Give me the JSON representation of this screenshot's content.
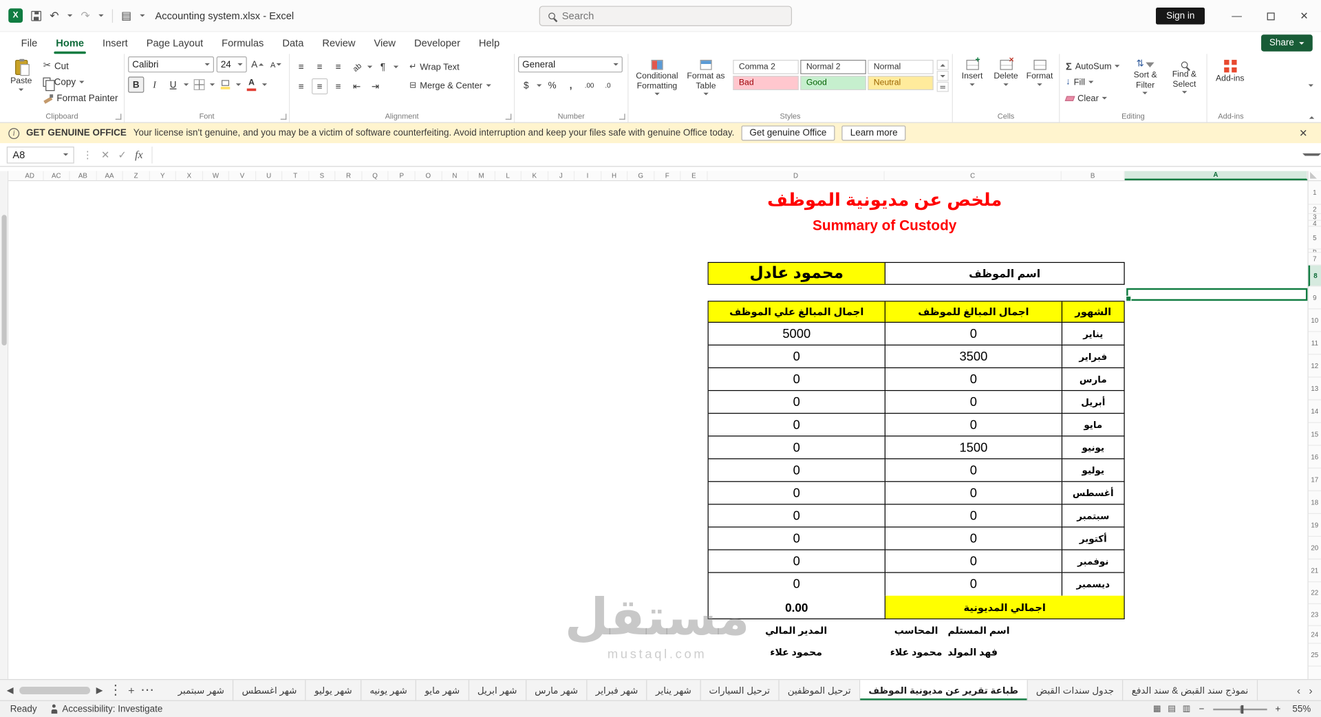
{
  "colors": {
    "excel_green": "#107C41",
    "share_button_green": "#185C37",
    "title_red": "#FF0000",
    "table_highlight_yellow": "#FFFF00",
    "license_bar_bg": "#FFF4CE",
    "style_bad_bg": "#FFC7CE",
    "style_bad_text": "#9C0006",
    "style_good_bg": "#C6EFCE",
    "style_good_text": "#006100",
    "style_neutral_bg": "#FFEB9C",
    "style_neutral_text": "#9C6500"
  },
  "icons": {
    "excel_logo": "X",
    "undo": "↶",
    "redo": "↷",
    "workbook": "▤",
    "minimize": "—",
    "close": "✕",
    "cancel": "✕",
    "confirm": "✓",
    "cut": "✂",
    "grow_font": "A",
    "shrink_font": "A",
    "orient": "ab",
    "paragraph": "¶",
    "align": "≡",
    "indent_out": "⇤",
    "indent_in": "⇥",
    "wrap": "↵",
    "merge": "⊟",
    "dollar": "$",
    "percent": "%",
    "comma": ",",
    "inc_decimal": ".00",
    "dec_decimal": ".0",
    "autosum": "Σ",
    "fill_down": "↓",
    "sort_arrows": "⇅",
    "dots_v": "⋮",
    "dots_h": "⋯",
    "plus": "+",
    "scroll_left": "◂",
    "scroll_right": "▸",
    "tab_prev": "‹",
    "tab_next": "›",
    "view_normal": "▦",
    "view_layout": "▤",
    "view_break": "▥",
    "zoom_out": "−",
    "zoom_in": "+",
    "info": "i"
  },
  "titlebar": {
    "document_title": "Accounting system.xlsx  -  Excel",
    "search_placeholder": "Search",
    "sign_in_label": "Sign in"
  },
  "menubar": {
    "tabs": [
      "File",
      "Home",
      "Insert",
      "Page Layout",
      "Formulas",
      "Data",
      "Review",
      "View",
      "Developer",
      "Help"
    ],
    "active_tab": "Home",
    "share_label": "Share"
  },
  "ribbon": {
    "clipboard": {
      "label": "Clipboard",
      "paste_label": "Paste",
      "cut_label": "Cut",
      "copy_label": "Copy",
      "format_painter_label": "Format Painter"
    },
    "font": {
      "label": "Font",
      "font_name": "Calibri",
      "font_size": "24",
      "bold_label": "B",
      "italic_label": "I",
      "underline_label": "U"
    },
    "alignment": {
      "label": "Alignment",
      "wrap_text_label": "Wrap Text",
      "merge_center_label": "Merge & Center"
    },
    "number": {
      "label": "Number",
      "format_value": "General"
    },
    "styles": {
      "label": "Styles",
      "conditional_formatting_label": "Conditional Formatting",
      "format_as_table_label": "Format as Table",
      "gallery": [
        "Comma 2",
        "Normal 2",
        "Normal",
        "Bad",
        "Good",
        "Neutral"
      ]
    },
    "cells": {
      "label": "Cells",
      "insert_label": "Insert",
      "delete_label": "Delete",
      "format_label": "Format"
    },
    "editing": {
      "label": "Editing",
      "autosum_label": "AutoSum",
      "fill_label": "Fill",
      "clear_label": "Clear",
      "sort_filter_label": "Sort & Filter",
      "find_select_label": "Find & Select"
    },
    "addins": {
      "label": "Add-ins",
      "addins_label": "Add-ins"
    }
  },
  "license_bar": {
    "badge": "GET GENUINE OFFICE",
    "message": "Your license isn't genuine, and you may be a victim of software counterfeiting. Avoid interruption and keep your files safe with genuine Office today.",
    "get_office_label": "Get genuine Office",
    "learn_more_label": "Learn more"
  },
  "formula_bar": {
    "name_box_value": "A8",
    "fx_label": "fx",
    "formula_value": ""
  },
  "grid": {
    "narrow_columns": [
      "AD",
      "AC",
      "AB",
      "AA",
      "Z",
      "Y",
      "X",
      "W",
      "V",
      "U",
      "T",
      "S",
      "R",
      "Q",
      "P",
      "O",
      "N",
      "M",
      "L",
      "K",
      "J",
      "I",
      "H",
      "G",
      "F",
      "E"
    ],
    "wide_columns": {
      "d": "D",
      "c": "C",
      "b": "B",
      "a": "A"
    },
    "row_numbers": [
      "1",
      "2",
      "3",
      "4",
      "5",
      "6",
      "7",
      "8",
      "9",
      "10",
      "11",
      "12",
      "13",
      "14",
      "15",
      "16",
      "17",
      "18",
      "19",
      "20",
      "21",
      "22",
      "23",
      "24",
      "25"
    ],
    "selected_cell": "A8"
  },
  "sheet": {
    "title_arabic": "ملخص عن مديونية الموظف",
    "title_english": "Summary of Custody",
    "employee_name_label": "اسم الموظف",
    "employee_name_value": "محمود عادل",
    "table": {
      "col_amounts_on_employee": "اجمال المبالغ علي الموظف",
      "col_amounts_for_employee": "اجمال المبالغ للموظف",
      "col_months": "الشهور",
      "rows": [
        {
          "month": "يناير",
          "amount_on": "5000",
          "amount_for": "0"
        },
        {
          "month": "فبراير",
          "amount_on": "0",
          "amount_for": "3500"
        },
        {
          "month": "مارس",
          "amount_on": "0",
          "amount_for": "0"
        },
        {
          "month": "أبريل",
          "amount_on": "0",
          "amount_for": "0"
        },
        {
          "month": "مايو",
          "amount_on": "0",
          "amount_for": "0"
        },
        {
          "month": "يونيو",
          "amount_on": "0",
          "amount_for": "1500"
        },
        {
          "month": "يوليو",
          "amount_on": "0",
          "amount_for": "0"
        },
        {
          "month": "أغسطس",
          "amount_on": "0",
          "amount_for": "0"
        },
        {
          "month": "سبتمبر",
          "amount_on": "0",
          "amount_for": "0"
        },
        {
          "month": "أكتوبر",
          "amount_on": "0",
          "amount_for": "0"
        },
        {
          "month": "نوفمبر",
          "amount_on": "0",
          "amount_for": "0"
        },
        {
          "month": "ديسمبر",
          "amount_on": "0",
          "amount_for": "0"
        }
      ],
      "total_label": "اجمالي المديونية",
      "total_value": "0.00"
    },
    "signatures": [
      {
        "role": "المدير المالي",
        "name": "محمود علاء"
      },
      {
        "role": "المحاسب",
        "name": "محمود علاء"
      },
      {
        "role": "اسم المستلم",
        "name": "فهد المولد"
      }
    ]
  },
  "sheet_tabs": {
    "tabs": [
      "شهر سبتمبر",
      "شهر اغسطس",
      "شهر يوليو",
      "شهر يونيه",
      "شهر مايو",
      "شهر ابريل",
      "شهر مارس",
      "شهر فبراير",
      "شهر يناير",
      "ترحيل السيارات",
      "ترحيل الموظفين",
      "طباعة تقرير عن مديونية الموظف",
      "جدول سندات القبض",
      "نموذج سند القبض & سند الدفع"
    ],
    "active_tab": "طباعة تقرير عن مديونية الموظف"
  },
  "status_bar": {
    "ready_label": "Ready",
    "accessibility_label": "Accessibility: Investigate",
    "zoom_level": "55%"
  },
  "watermark": {
    "text": "مستقل",
    "domain": "mustaql.com"
  }
}
